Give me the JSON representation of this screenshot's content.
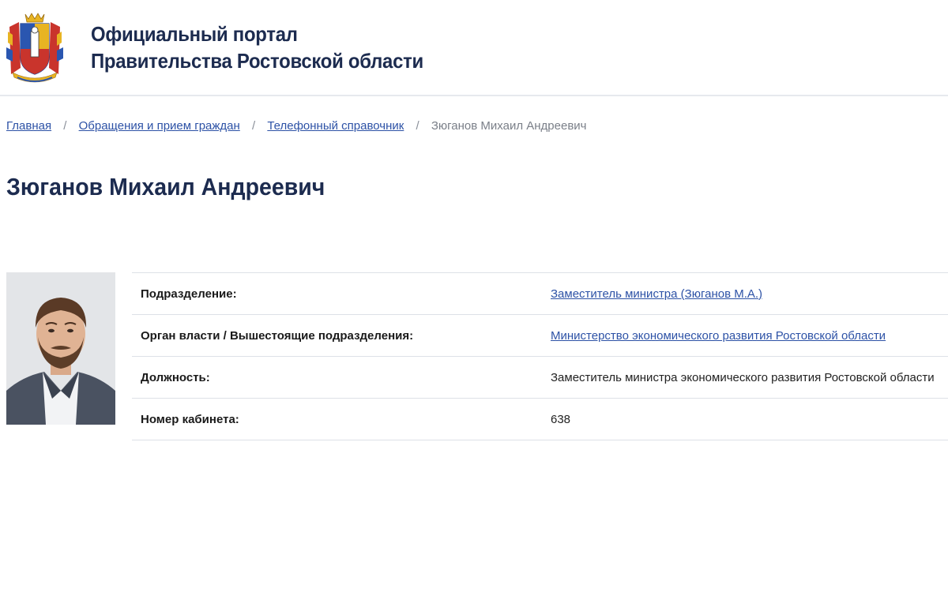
{
  "header": {
    "title_line1": "Официальный портал",
    "title_line2": "Правительства Ростовской области",
    "emblem_icon": "rostov-oblast-coat-of-arms-icon"
  },
  "breadcrumb": [
    {
      "label": "Главная"
    },
    {
      "label": "Обращения и прием граждан"
    },
    {
      "label": "Телефонный справочник"
    },
    {
      "label": "Зюганов Михаил Андреевич"
    }
  ],
  "breadcrumb_separator": "/",
  "page_title": "Зюганов Михаил Андреевич",
  "profile": {
    "rows": [
      {
        "label": "Подразделение:",
        "value": "Заместитель министра (Зюганов М.А.)"
      },
      {
        "label": "Орган власти / Вышестоящие подразделения:",
        "value": "Министерство экономического развития Ростовской области"
      },
      {
        "label": "Должность:",
        "value": "Заместитель министра экономического развития Ростовской области"
      },
      {
        "label": "Номер кабинета:",
        "value": "638"
      }
    ]
  },
  "colors": {
    "title": "#1c2b4f",
    "link": "#2d52a6",
    "muted": "#7a7f88",
    "border": "#dde1e7"
  }
}
